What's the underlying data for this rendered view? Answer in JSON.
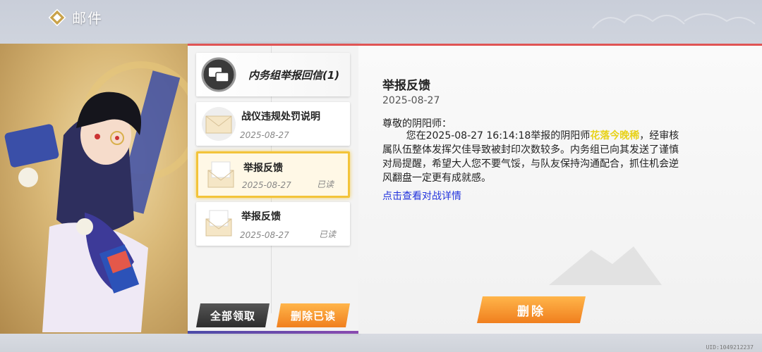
{
  "header": {
    "title": "邮件"
  },
  "mail_list": [
    {
      "subject": "内务组举报回信(1)",
      "date": "",
      "status": "",
      "type": "group"
    },
    {
      "subject": "战仪违规处罚说明",
      "date": "2025-08-27",
      "status": "",
      "type": "mail"
    },
    {
      "subject": "举报反馈",
      "date": "2025-08-27",
      "status": "已读",
      "type": "mail",
      "selected": true
    },
    {
      "subject": "举报反馈",
      "date": "2025-08-27",
      "status": "已读",
      "type": "mail"
    }
  ],
  "list_actions": {
    "claim_all": "全部领取",
    "delete_read": "删除已读"
  },
  "detail": {
    "title": "举报反馈",
    "date": "2025-08-27",
    "greeting": "尊敬的阴阳师：",
    "body_before": "您在2025-08-27 16:14:18举报的阴阳师",
    "highlight_name": "花落今晚稀",
    "body_after": "，经审核属队伍整体发挥欠佳导致被封印次数较多。内务组已向其发送了谨慎对局提醒，希望大人您不要气馁，与队友保持沟通配合，抓住机会逆风翻盘一定更有成就感。",
    "link": "点击查看对战详情",
    "delete_label": "删除"
  },
  "footer": {
    "uid": "UID:1049212237"
  },
  "colors": {
    "accent_red": "#e05454",
    "orange_button": "#f07f1e",
    "selected_border": "#f3c43a",
    "link": "#2233dd",
    "highlight": "#e8d21a"
  }
}
